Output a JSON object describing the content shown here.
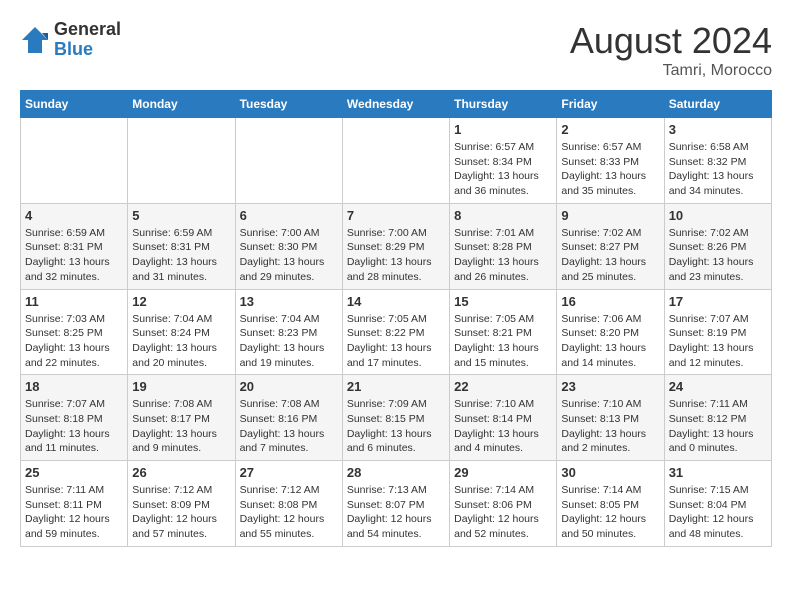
{
  "header": {
    "logo_general": "General",
    "logo_blue": "Blue",
    "month_year": "August 2024",
    "location": "Tamri, Morocco"
  },
  "days_of_week": [
    "Sunday",
    "Monday",
    "Tuesday",
    "Wednesday",
    "Thursday",
    "Friday",
    "Saturday"
  ],
  "weeks": [
    [
      {
        "day": "",
        "info": ""
      },
      {
        "day": "",
        "info": ""
      },
      {
        "day": "",
        "info": ""
      },
      {
        "day": "",
        "info": ""
      },
      {
        "day": "1",
        "info": "Sunrise: 6:57 AM\nSunset: 8:34 PM\nDaylight: 13 hours\nand 36 minutes."
      },
      {
        "day": "2",
        "info": "Sunrise: 6:57 AM\nSunset: 8:33 PM\nDaylight: 13 hours\nand 35 minutes."
      },
      {
        "day": "3",
        "info": "Sunrise: 6:58 AM\nSunset: 8:32 PM\nDaylight: 13 hours\nand 34 minutes."
      }
    ],
    [
      {
        "day": "4",
        "info": "Sunrise: 6:59 AM\nSunset: 8:31 PM\nDaylight: 13 hours\nand 32 minutes."
      },
      {
        "day": "5",
        "info": "Sunrise: 6:59 AM\nSunset: 8:31 PM\nDaylight: 13 hours\nand 31 minutes."
      },
      {
        "day": "6",
        "info": "Sunrise: 7:00 AM\nSunset: 8:30 PM\nDaylight: 13 hours\nand 29 minutes."
      },
      {
        "day": "7",
        "info": "Sunrise: 7:00 AM\nSunset: 8:29 PM\nDaylight: 13 hours\nand 28 minutes."
      },
      {
        "day": "8",
        "info": "Sunrise: 7:01 AM\nSunset: 8:28 PM\nDaylight: 13 hours\nand 26 minutes."
      },
      {
        "day": "9",
        "info": "Sunrise: 7:02 AM\nSunset: 8:27 PM\nDaylight: 13 hours\nand 25 minutes."
      },
      {
        "day": "10",
        "info": "Sunrise: 7:02 AM\nSunset: 8:26 PM\nDaylight: 13 hours\nand 23 minutes."
      }
    ],
    [
      {
        "day": "11",
        "info": "Sunrise: 7:03 AM\nSunset: 8:25 PM\nDaylight: 13 hours\nand 22 minutes."
      },
      {
        "day": "12",
        "info": "Sunrise: 7:04 AM\nSunset: 8:24 PM\nDaylight: 13 hours\nand 20 minutes."
      },
      {
        "day": "13",
        "info": "Sunrise: 7:04 AM\nSunset: 8:23 PM\nDaylight: 13 hours\nand 19 minutes."
      },
      {
        "day": "14",
        "info": "Sunrise: 7:05 AM\nSunset: 8:22 PM\nDaylight: 13 hours\nand 17 minutes."
      },
      {
        "day": "15",
        "info": "Sunrise: 7:05 AM\nSunset: 8:21 PM\nDaylight: 13 hours\nand 15 minutes."
      },
      {
        "day": "16",
        "info": "Sunrise: 7:06 AM\nSunset: 8:20 PM\nDaylight: 13 hours\nand 14 minutes."
      },
      {
        "day": "17",
        "info": "Sunrise: 7:07 AM\nSunset: 8:19 PM\nDaylight: 13 hours\nand 12 minutes."
      }
    ],
    [
      {
        "day": "18",
        "info": "Sunrise: 7:07 AM\nSunset: 8:18 PM\nDaylight: 13 hours\nand 11 minutes."
      },
      {
        "day": "19",
        "info": "Sunrise: 7:08 AM\nSunset: 8:17 PM\nDaylight: 13 hours\nand 9 minutes."
      },
      {
        "day": "20",
        "info": "Sunrise: 7:08 AM\nSunset: 8:16 PM\nDaylight: 13 hours\nand 7 minutes."
      },
      {
        "day": "21",
        "info": "Sunrise: 7:09 AM\nSunset: 8:15 PM\nDaylight: 13 hours\nand 6 minutes."
      },
      {
        "day": "22",
        "info": "Sunrise: 7:10 AM\nSunset: 8:14 PM\nDaylight: 13 hours\nand 4 minutes."
      },
      {
        "day": "23",
        "info": "Sunrise: 7:10 AM\nSunset: 8:13 PM\nDaylight: 13 hours\nand 2 minutes."
      },
      {
        "day": "24",
        "info": "Sunrise: 7:11 AM\nSunset: 8:12 PM\nDaylight: 13 hours\nand 0 minutes."
      }
    ],
    [
      {
        "day": "25",
        "info": "Sunrise: 7:11 AM\nSunset: 8:11 PM\nDaylight: 12 hours\nand 59 minutes."
      },
      {
        "day": "26",
        "info": "Sunrise: 7:12 AM\nSunset: 8:09 PM\nDaylight: 12 hours\nand 57 minutes."
      },
      {
        "day": "27",
        "info": "Sunrise: 7:12 AM\nSunset: 8:08 PM\nDaylight: 12 hours\nand 55 minutes."
      },
      {
        "day": "28",
        "info": "Sunrise: 7:13 AM\nSunset: 8:07 PM\nDaylight: 12 hours\nand 54 minutes."
      },
      {
        "day": "29",
        "info": "Sunrise: 7:14 AM\nSunset: 8:06 PM\nDaylight: 12 hours\nand 52 minutes."
      },
      {
        "day": "30",
        "info": "Sunrise: 7:14 AM\nSunset: 8:05 PM\nDaylight: 12 hours\nand 50 minutes."
      },
      {
        "day": "31",
        "info": "Sunrise: 7:15 AM\nSunset: 8:04 PM\nDaylight: 12 hours\nand 48 minutes."
      }
    ]
  ]
}
